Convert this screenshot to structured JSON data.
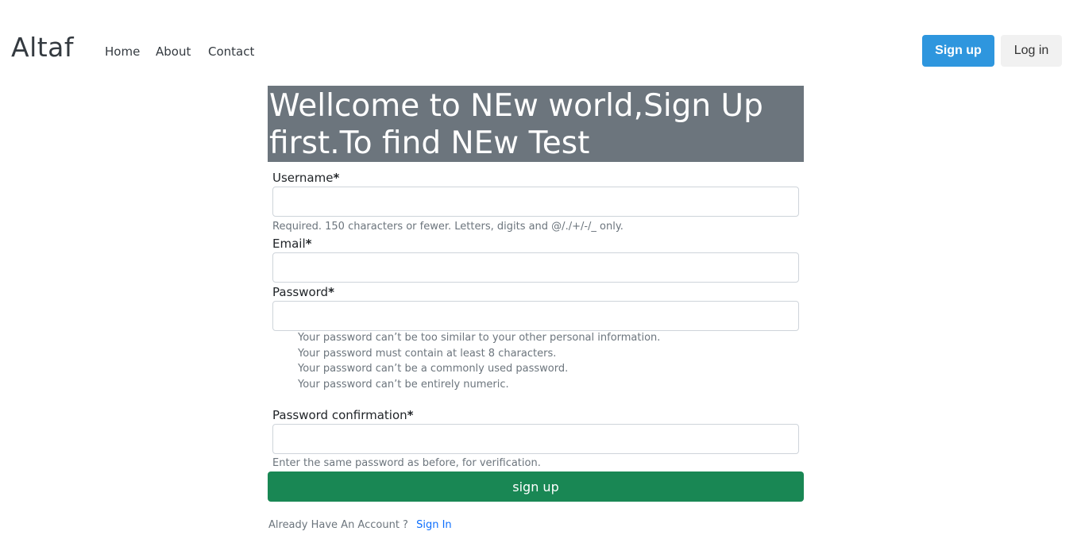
{
  "nav": {
    "brand": "Altaf",
    "links": [
      "Home",
      "About",
      "Contact"
    ],
    "signup_label": "Sign up",
    "login_label": "Log in"
  },
  "hero": {
    "title": "Wellcome to NEw world,Sign Up first.To find NEw Test"
  },
  "form": {
    "username_label": "Username",
    "username_value": "",
    "username_help": "Required. 150 characters or fewer. Letters, digits and @/./+/-/_ only.",
    "email_label": "Email",
    "email_value": "",
    "password_label": "Password",
    "password_value": "",
    "password_rules": [
      "Your password can’t be too similar to your other personal information.",
      "Your password must contain at least 8 characters.",
      "Your password can’t be a commonly used password.",
      "Your password can’t be entirely numeric."
    ],
    "password2_label": "Password confirmation",
    "password2_value": "",
    "password2_help": "Enter the same password as before, for verification.",
    "required_mark": "*",
    "submit_label": "sign up"
  },
  "footer": {
    "prompt": "Already Have An Account ?",
    "signin_label": "Sign In"
  },
  "colors": {
    "primary": "#2e96de",
    "hero_bg": "#6c757d",
    "success": "#198754",
    "link": "#0d6efd"
  }
}
